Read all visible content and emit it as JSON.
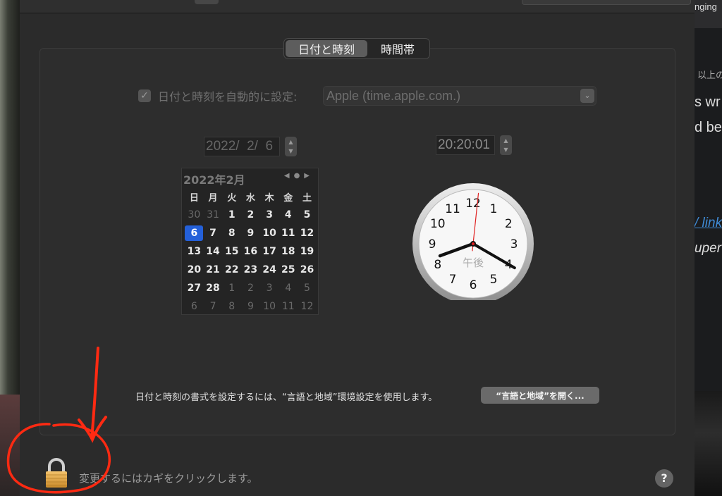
{
  "tabs": [
    {
      "label": "日付と時刻",
      "active": true
    },
    {
      "label": "時間帯",
      "active": false
    }
  ],
  "auto_set": {
    "checked": true,
    "label": "日付と時刻を自動的に設定:",
    "server": "Apple (time.apple.com.)"
  },
  "date_field": "2022/  2/  6",
  "time_field": "20:20:01",
  "calendar": {
    "month_title": "2022年2月",
    "weekdays": [
      "日",
      "月",
      "火",
      "水",
      "木",
      "金",
      "土"
    ],
    "weeks": [
      [
        {
          "d": "30",
          "dim": true
        },
        {
          "d": "31",
          "dim": true
        },
        {
          "d": "1"
        },
        {
          "d": "2"
        },
        {
          "d": "3"
        },
        {
          "d": "4"
        },
        {
          "d": "5"
        }
      ],
      [
        {
          "d": "6",
          "sel": true
        },
        {
          "d": "7"
        },
        {
          "d": "8"
        },
        {
          "d": "9"
        },
        {
          "d": "10"
        },
        {
          "d": "11"
        },
        {
          "d": "12"
        }
      ],
      [
        {
          "d": "13"
        },
        {
          "d": "14"
        },
        {
          "d": "15"
        },
        {
          "d": "16"
        },
        {
          "d": "17"
        },
        {
          "d": "18"
        },
        {
          "d": "19"
        }
      ],
      [
        {
          "d": "20"
        },
        {
          "d": "21"
        },
        {
          "d": "22"
        },
        {
          "d": "23"
        },
        {
          "d": "24"
        },
        {
          "d": "25"
        },
        {
          "d": "26"
        }
      ],
      [
        {
          "d": "27"
        },
        {
          "d": "28"
        },
        {
          "d": "1",
          "dim": true
        },
        {
          "d": "2",
          "dim": true
        },
        {
          "d": "3",
          "dim": true
        },
        {
          "d": "4",
          "dim": true
        },
        {
          "d": "5",
          "dim": true
        }
      ],
      [
        {
          "d": "6",
          "dim": true
        },
        {
          "d": "7",
          "dim": true
        },
        {
          "d": "8",
          "dim": true
        },
        {
          "d": "9",
          "dim": true
        },
        {
          "d": "10",
          "dim": true
        },
        {
          "d": "11",
          "dim": true
        },
        {
          "d": "12",
          "dim": true
        }
      ]
    ]
  },
  "clock": {
    "numbers": [
      "12",
      "1",
      "2",
      "3",
      "4",
      "5",
      "6",
      "7",
      "8",
      "9",
      "10",
      "11"
    ],
    "ampm": "午後",
    "hour": 20,
    "minute": 20,
    "second": 1
  },
  "format_hint": "日付と時刻の書式を設定するには、“言語と地域”環境設定を使用します。",
  "open_button": "“言語と地域”を開く...",
  "lock_text": "変更するにはカギをクリックします。",
  "help_label": "?",
  "background_fragments": {
    "top": "nging",
    "row1": "以上の",
    "row2": "s wr",
    "row3": "d be",
    "row4": "/ link",
    "row5": "uper"
  },
  "colors": {
    "accent": "#2460d9",
    "annotation": "#ff2a12",
    "link": "#3f8bd6"
  }
}
